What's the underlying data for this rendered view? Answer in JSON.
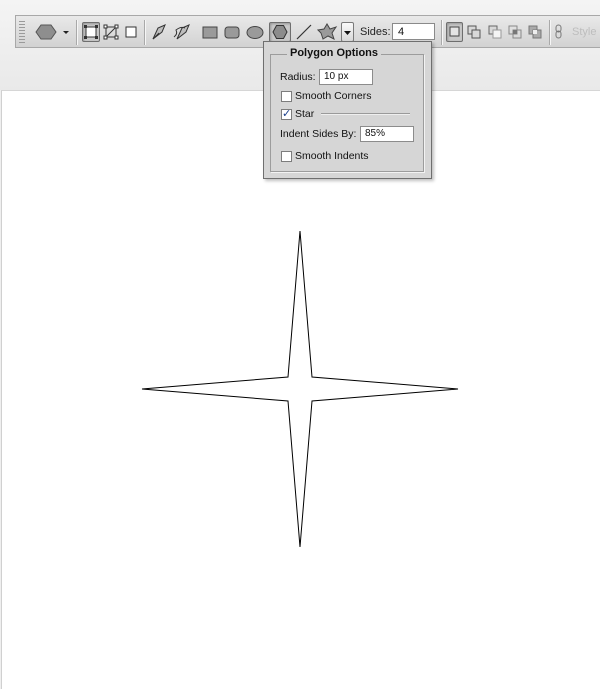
{
  "toolbar": {
    "sides_label": "Sides:",
    "sides_value": "4",
    "style_label": "Style",
    "tools": [
      "polygon-preset-picker",
      "shape-layers",
      "paths",
      "fill-pixels",
      "pen",
      "freeform-pen",
      "rectangle",
      "rounded-rectangle",
      "ellipse",
      "polygon",
      "line",
      "custom-shape",
      "geometry-options"
    ],
    "selected_tool": "polygon"
  },
  "popup": {
    "title": "Polygon Options",
    "radius_label": "Radius:",
    "radius_value": "10 px",
    "smooth_corners_label": "Smooth Corners",
    "smooth_corners_checked": false,
    "star_label": "Star",
    "star_checked": true,
    "indent_label": "Indent Sides By:",
    "indent_value": "85%",
    "smooth_indents_label": "Smooth Indents",
    "smooth_indents_checked": false
  },
  "canvas": {
    "shape": "four-point-star",
    "fill": "#ffffff",
    "stroke": "#000000"
  },
  "colors": {
    "toolbar_bg": "#dcdcdc",
    "popup_bg": "#d6d6d6",
    "canvas_bg": "#ffffff",
    "check_mark": "#1a3f8c"
  },
  "check_glyph": "✓"
}
